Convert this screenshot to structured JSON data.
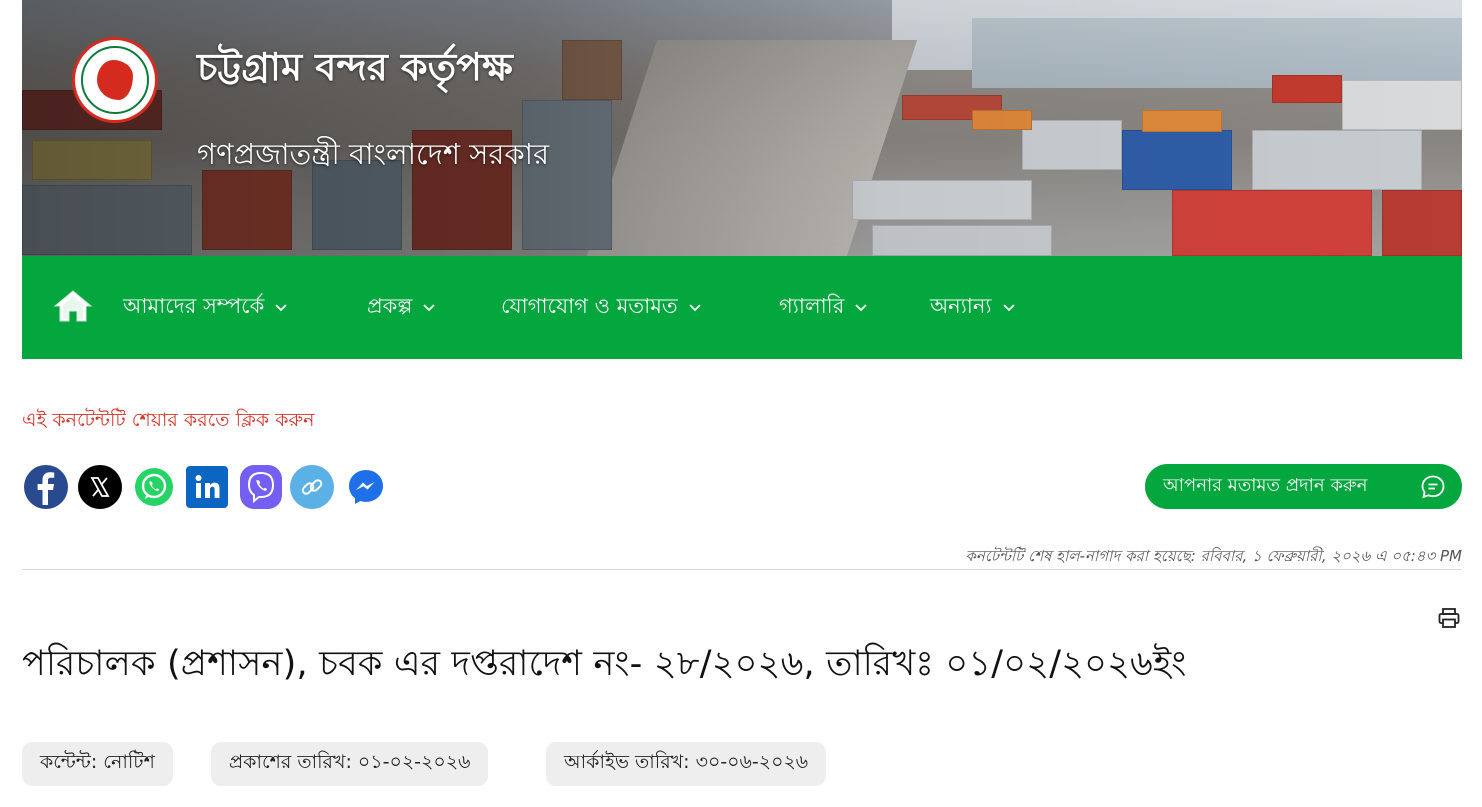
{
  "header": {
    "title": "চট্টগ্রাম বন্দর কর্তৃপক্ষ",
    "subtitle": "গণপ্রজাতন্ত্রী বাংলাদেশ সরকার",
    "emblem_icon": "bangladesh-govt-emblem"
  },
  "nav": {
    "background": "#04a73e",
    "home_icon": "home-icon",
    "items": [
      {
        "label": "আমাদের সম্পর্কে"
      },
      {
        "label": "প্রকল্প"
      },
      {
        "label": "যোগাযোগ ও মতামত"
      },
      {
        "label": "গ্যালারি"
      },
      {
        "label": "অন্যান্য"
      }
    ]
  },
  "share": {
    "prompt": "এই কনটেন্টটি শেয়ার করতে ক্লিক করুন",
    "prompt_color": "#d8342a",
    "icons": [
      "facebook-icon",
      "x-icon",
      "whatsapp-icon",
      "linkedin-icon",
      "viber-icon",
      "copy-link-icon",
      "messenger-icon"
    ]
  },
  "feedback": {
    "label": "আপনার মতামত প্রদান করুন",
    "icon": "chat-bubble-icon"
  },
  "last_updated": "কনটেন্টটি শেষ হাল-নাগাদ করা হয়েছে: রবিবার, ১ ফেব্রুয়ারী, ২০২৬ এ ০৫:৪৩ PM",
  "content": {
    "title": "পরিচালক (প্রশাসন), চবক এর দপ্তরাদেশ নং- ২৮/২০২৬, তারিখঃ ০১/০২/২০২৬ইং",
    "print_icon": "print-icon",
    "meta": [
      {
        "text": "কন্টেন্ট: নোটিশ"
      },
      {
        "text": "প্রকাশের তারিখ: ০১-০২-২০২৬"
      },
      {
        "text": "আর্কাইভ তারিখ: ৩০-০৬-২০২৬"
      }
    ]
  }
}
